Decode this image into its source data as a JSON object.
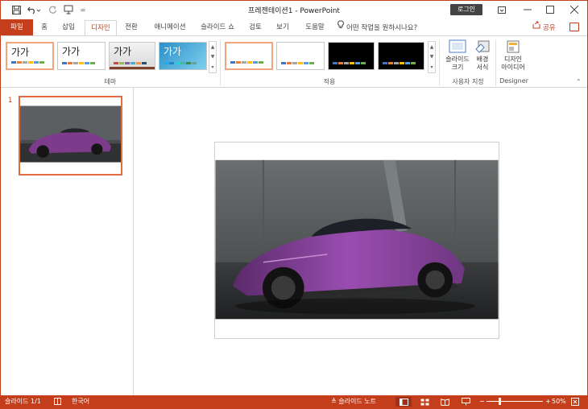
{
  "titlebar": {
    "document_title": "프레젠테이션1  -  PowerPoint",
    "login_label": "로그인"
  },
  "tabs": [
    {
      "label": "파일",
      "name": "tab-file"
    },
    {
      "label": "홈",
      "name": "tab-home"
    },
    {
      "label": "삽입",
      "name": "tab-insert"
    },
    {
      "label": "디자인",
      "name": "tab-design"
    },
    {
      "label": "전환",
      "name": "tab-transitions"
    },
    {
      "label": "애니메이션",
      "name": "tab-animations"
    },
    {
      "label": "슬라이드 쇼",
      "name": "tab-slideshow"
    },
    {
      "label": "검토",
      "name": "tab-review"
    },
    {
      "label": "보기",
      "name": "tab-view"
    },
    {
      "label": "도움말",
      "name": "tab-help"
    }
  ],
  "tell_me": "어떤 작업을 원하시나요?",
  "share_label": "공유",
  "ribbon": {
    "themes_label": "테마",
    "theme_thumb_text": [
      "가가",
      "가가",
      "가가",
      "가가"
    ],
    "variants_label": "적용",
    "slide_size": "슬라이드\n크기",
    "format_background": "배경\n서식",
    "customize_label": "사용자 지정",
    "design_ideas": "디자인\n아이디어",
    "designer_label": "Designer"
  },
  "thumbnail_pane": {
    "slide_number": "1"
  },
  "statusbar": {
    "slide_info": "슬라이드 1/1",
    "language": "한국어",
    "notes_label": "슬라이드 노트",
    "zoom": "50%"
  },
  "colors": {
    "accent": "#c43e1c",
    "selection": "#e46c44"
  }
}
